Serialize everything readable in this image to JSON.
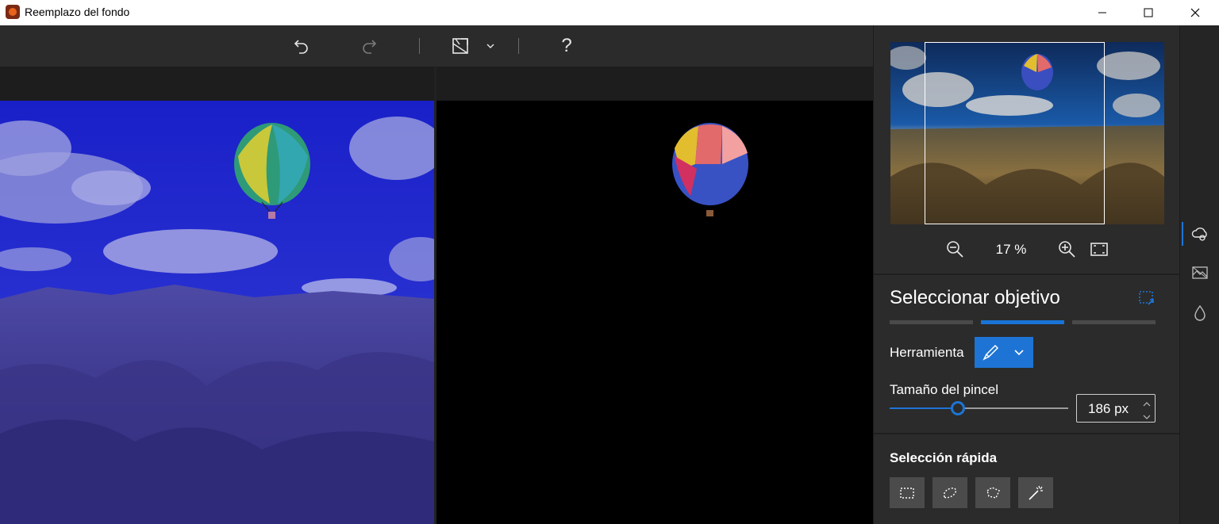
{
  "window": {
    "title": "Reemplazo del fondo"
  },
  "toolbar": {
    "undo": "undo-icon",
    "redo": "redo-icon",
    "view": "image-view-icon",
    "help_label": "?"
  },
  "navigator": {
    "zoom_value": "17 %"
  },
  "panel": {
    "title": "Seleccionar objetivo",
    "tool_label": "Herramienta",
    "brush_size_label": "Tamaño del pincel",
    "brush_size_value": "186 px",
    "brush_size_slider": 0.38,
    "quick_select_label": "Selección rápida"
  },
  "colors": {
    "accent": "#1e74d4",
    "background": "#2b2b2b",
    "titlebar": "#ffffff"
  }
}
